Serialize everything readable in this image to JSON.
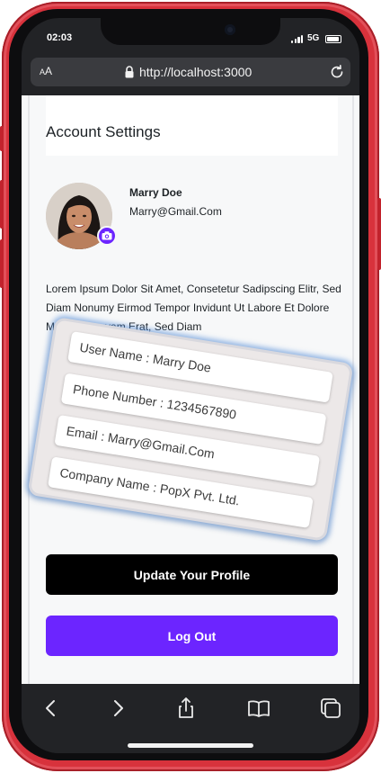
{
  "status_bar": {
    "time": "02:03",
    "network": "5G",
    "battery_level": 0.95
  },
  "browser": {
    "text_size_label": "AA",
    "url": "http://localhost:3000"
  },
  "page": {
    "title": "Account Settings",
    "profile": {
      "name": "Marry Doe",
      "email": "Marry@Gmail.Com"
    },
    "bio": "Lorem Ipsum Dolor Sit Amet, Consetetur Sadipscing Elitr, Sed Diam Nonumy Eirmod Tempor Invidunt Ut Labore Et Dolore Magna Aliquyam Erat, Sed Diam",
    "details": [
      "User Name : Marry Doe",
      "Phone Number : 1234567890",
      "Email : Marry@Gmail.Com",
      "Company Name : PopX Pvt. Ltd."
    ],
    "update_button": "Update Your Profile",
    "logout_button": "Log Out"
  },
  "toolbar": {
    "icons": [
      "back-icon",
      "forward-icon",
      "share-icon",
      "bookmarks-icon",
      "tabs-icon"
    ]
  },
  "colors": {
    "phone_frame": "#d8323c",
    "accent": "#6c25ff",
    "primary_button": "#000000"
  }
}
